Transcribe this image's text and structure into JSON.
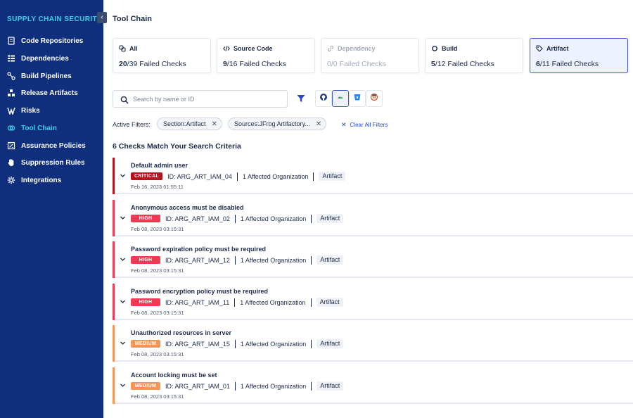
{
  "sidebar": {
    "title": "SUPPLY CHAIN SECURITY",
    "collapse_icon": "chevron-left-icon",
    "items": [
      {
        "label": "Code Repositories",
        "icon": "code-repo-icon"
      },
      {
        "label": "Dependencies",
        "icon": "dependencies-icon"
      },
      {
        "label": "Build Pipelines",
        "icon": "pipeline-icon"
      },
      {
        "label": "Release Artifacts",
        "icon": "artifacts-icon"
      },
      {
        "label": "Risks",
        "icon": "risk-icon"
      },
      {
        "label": "Tool Chain",
        "icon": "toolchain-icon",
        "active": true
      },
      {
        "label": "Assurance Policies",
        "icon": "policy-icon"
      },
      {
        "label": "Suppression Rules",
        "icon": "hand-icon"
      },
      {
        "label": "Integrations",
        "icon": "gear-icon"
      }
    ],
    "bg_color": "#0f2f7d",
    "active_color": "#3fd0e6"
  },
  "main": {
    "title": "Tool Chain",
    "cards": [
      {
        "label": "All",
        "failed": "20",
        "total": "/39",
        "suffix": " Failed Checks",
        "icon": "link-icon"
      },
      {
        "label": "Source Code",
        "failed": "9",
        "total": "/16",
        "suffix": " Failed Checks",
        "icon": "code-icon"
      },
      {
        "label": "Dependency",
        "failed": "0",
        "total": "/0",
        "suffix": " Failed Checks",
        "icon": "dependency-link-icon",
        "disabled": true
      },
      {
        "label": "Build",
        "failed": "5",
        "total": "/12",
        "suffix": " Failed Checks",
        "icon": "build-icon"
      },
      {
        "label": "Artifact",
        "failed": "6",
        "total": "/11",
        "suffix": " Failed Checks",
        "icon": "artifact-icon",
        "selected": true
      }
    ],
    "search": {
      "placeholder": "Search by name or ID",
      "value": ""
    },
    "sources": [
      {
        "name": "github-icon"
      },
      {
        "name": "jfrog-icon",
        "selected": true
      },
      {
        "name": "bitbucket-icon"
      },
      {
        "name": "jenkins-icon"
      }
    ],
    "active_filters_label": "Active Filters:",
    "filters": [
      {
        "label": "Section:Artifact"
      },
      {
        "label": "Sources:JFrog Artifactory..."
      }
    ],
    "clear_all_label": "Clear All Filters",
    "results_title": "6 Checks Match Your Search Criteria",
    "checks": [
      {
        "title": "Default admin user",
        "severity": "CRITICAL",
        "level": "critical",
        "id": "ID: ARG_ART_IAM_04",
        "orgs": "1 Affected Organization",
        "section": "Artifact",
        "date": "Feb 16, 2023 01:55:11",
        "color": "#b8121f"
      },
      {
        "title": "Anonymous access must be disabled",
        "severity": "HIGH",
        "level": "high",
        "id": "ID: ARG_ART_IAM_02",
        "orgs": "1 Affected Organization",
        "section": "Artifact",
        "date": "Feb 08, 2023 03:15:31",
        "color": "#f03a55"
      },
      {
        "title": "Password expiration policy must be required",
        "severity": "HIGH",
        "level": "high",
        "id": "ID: ARG_ART_IAM_12",
        "orgs": "1 Affected Organization",
        "section": "Artifact",
        "date": "Feb 08, 2023 03:15:31",
        "color": "#f03a55"
      },
      {
        "title": "Password encryption policy must be required",
        "severity": "HIGH",
        "level": "high",
        "id": "ID: ARG_ART_IAM_11",
        "orgs": "1 Affected Organization",
        "section": "Artifact",
        "date": "Feb 08, 2023 03:15:31",
        "color": "#f03a55"
      },
      {
        "title": "Unauthorized resources in server",
        "severity": "MEDIUM",
        "level": "medium",
        "id": "ID: ARG_ART_IAM_15",
        "orgs": "1 Affected Organization",
        "section": "Artifact",
        "date": "Feb 08, 2023 03:15:31",
        "color": "#f59659"
      },
      {
        "title": "Account locking must be set",
        "severity": "MEDIUM",
        "level": "medium",
        "id": "ID: ARG_ART_IAM_01",
        "orgs": "1 Affected Organization",
        "section": "Artifact",
        "date": "Feb 08, 2023 03:15:31",
        "color": "#f59659"
      }
    ]
  }
}
